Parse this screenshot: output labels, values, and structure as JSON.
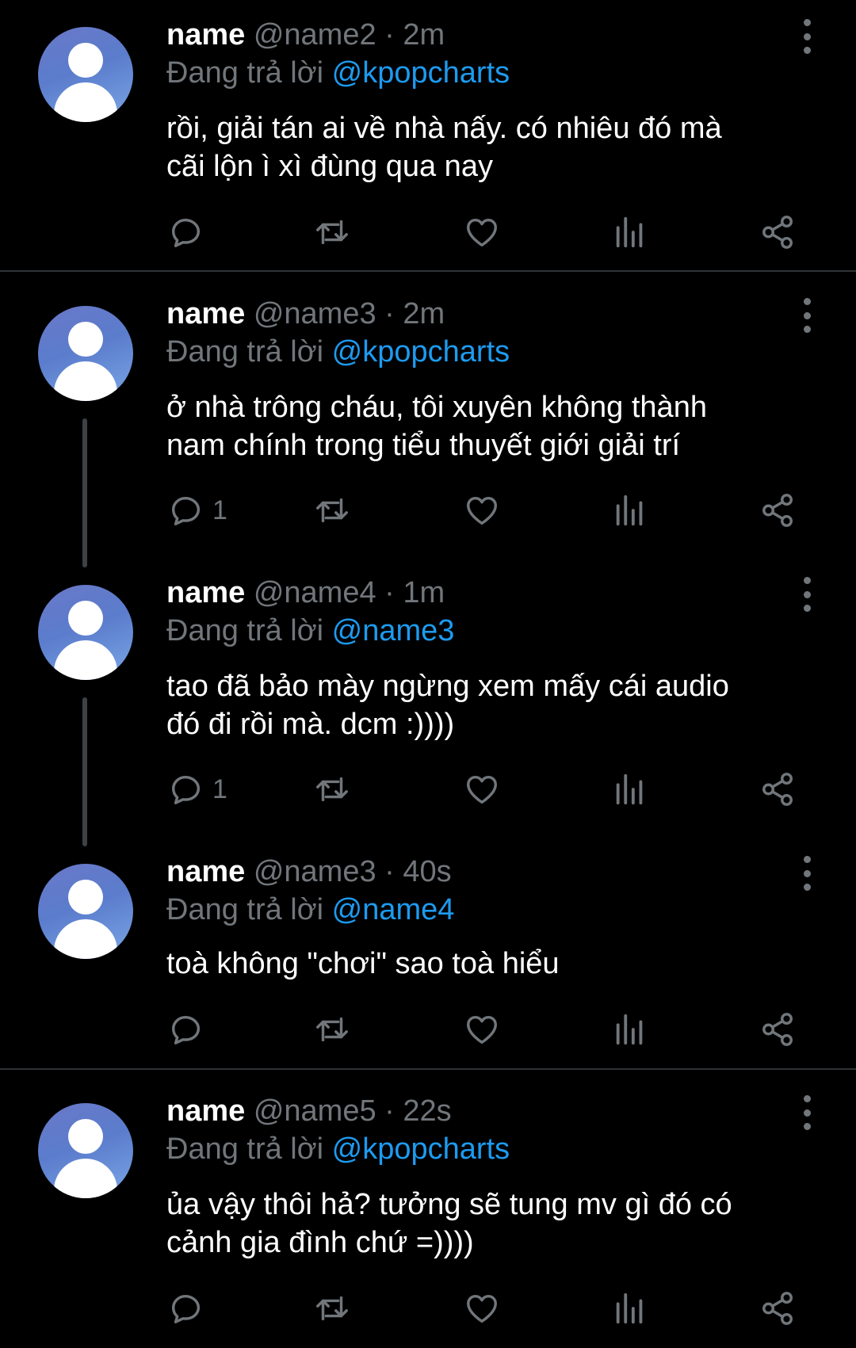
{
  "colors": {
    "background": "#000000",
    "text": "#ffffff",
    "secondary": "#71767b",
    "mention": "#1d9bf0",
    "divider": "#2f3336"
  },
  "reply_prefix": "Đang trả lời",
  "tweets": [
    {
      "display_name": "name",
      "meta": "@name2 · 2m",
      "reply_to": "@kpopcharts",
      "text_lines": [
        "rồi, giải tán ai về nhà nấy. có nhiêu đó mà",
        "cãi lộn ì xì đùng qua nay"
      ],
      "reply_count": "",
      "icons": [
        "reply-icon",
        "retweet-icon",
        "like-icon",
        "views-icon",
        "share-icon"
      ]
    },
    {
      "display_name": "name",
      "meta": "@name3 · 2m",
      "reply_to": "@kpopcharts",
      "text_lines": [
        "ở nhà trông cháu, tôi xuyên không thành",
        "nam chính trong tiểu thuyết giới giải trí"
      ],
      "reply_count": "1"
    },
    {
      "display_name": "name",
      "meta": "@name4 · 1m",
      "reply_to": "@name3",
      "text_lines": [
        "tao đã bảo mày ngừng xem mấy cái audio",
        "đó đi rồi mà. dcm :))))"
      ],
      "reply_count": "1"
    },
    {
      "display_name": "name",
      "meta": "@name3 · 40s",
      "reply_to": "@name4",
      "text_lines": [
        "toà không \"chơi\" sao toà hiểu"
      ],
      "reply_count": ""
    },
    {
      "display_name": "name",
      "meta": "@name5 · 22s",
      "reply_to": "@kpopcharts",
      "text_lines": [
        "ủa vậy thôi hả? tưởng sẽ tung mv gì đó có",
        "cảnh gia đình chứ =))))"
      ],
      "reply_count": ""
    }
  ]
}
